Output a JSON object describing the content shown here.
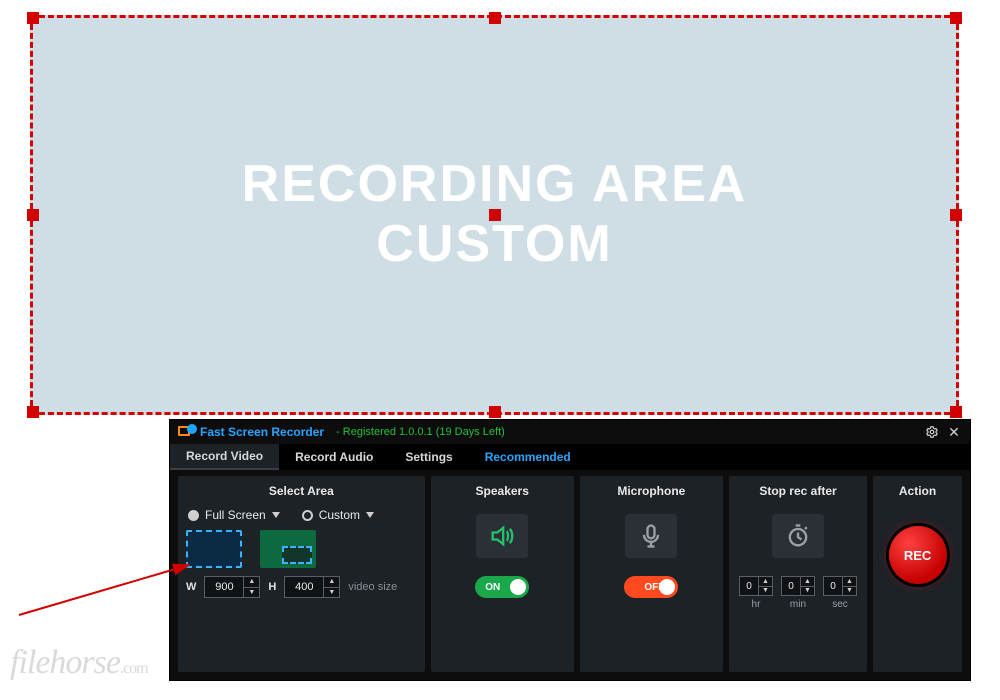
{
  "recording_area": {
    "line1": "RECORDING AREA",
    "line2": "CUSTOM"
  },
  "app": {
    "title": "Fast Screen Recorder",
    "registration": "- Registered 1.0.0.1 (19 Days Left)"
  },
  "tabs": {
    "video": "Record Video",
    "audio": "Record Audio",
    "settings": "Settings",
    "recommended": "Recommended"
  },
  "select_area": {
    "header": "Select Area",
    "full_screen": "Full Screen",
    "custom": "Custom",
    "width_label": "W",
    "width_value": "900",
    "height_label": "H",
    "height_value": "400",
    "video_size": "video size"
  },
  "speakers": {
    "header": "Speakers",
    "state": "ON"
  },
  "microphone": {
    "header": "Microphone",
    "state": "OFF"
  },
  "stop": {
    "header": "Stop rec after",
    "hr_value": "0",
    "min_value": "0",
    "sec_value": "0",
    "hr_label": "hr",
    "min_label": "min",
    "sec_label": "sec"
  },
  "action": {
    "header": "Action",
    "button": "REC"
  },
  "watermark": {
    "brand": "filehorse",
    "tld": ".com"
  }
}
